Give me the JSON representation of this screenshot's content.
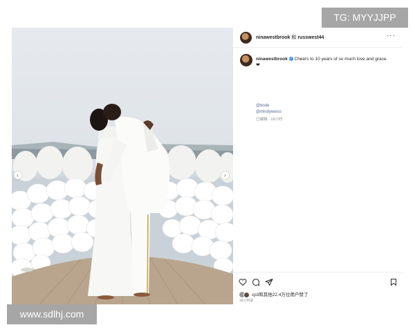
{
  "header": {
    "user1": "ninawestbrook",
    "joiner": "和",
    "user2": "russwest44",
    "more": "···"
  },
  "caption": {
    "username": "ninawestbrook",
    "text": "Cheers to 10 years of so much love and grace.",
    "emoji": "❤",
    "mentions": [
      "@bode",
      "@mindyweiss"
    ],
    "meta": "已编辑 · 18小时"
  },
  "actions": {
    "icons": [
      "heart-icon",
      "comment-icon",
      "share-icon",
      "bookmark-icon"
    ],
    "likes_text": "cp3和其他22.4万位用户赞了",
    "time": "18小时前"
  },
  "watermarks": {
    "top_right": "TG: MYYJJPP",
    "bottom_left": "www.sdlhj.com"
  },
  "carousel": {
    "prev": "‹",
    "next": "›"
  }
}
